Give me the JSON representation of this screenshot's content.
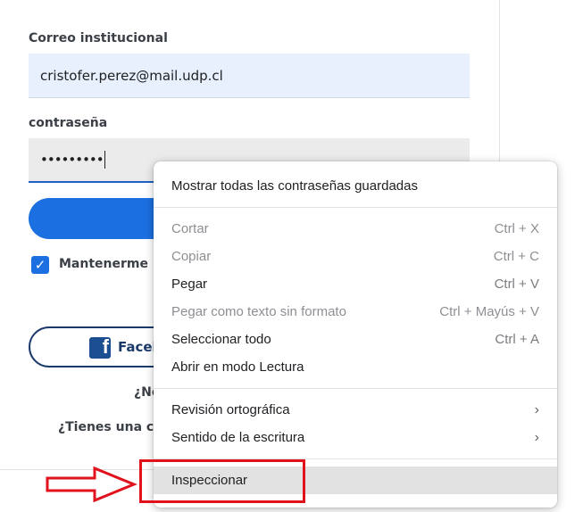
{
  "form": {
    "email_label": "Correo institucional",
    "email_value": "cristofer.perez@mail.udp.cl",
    "password_label": "contraseña",
    "password_value": "•••••••••",
    "remember_label": "Mantenerme re",
    "facebook_label": "Faceb",
    "forgot_text": "¿No",
    "account_text": "¿Tienes una cu"
  },
  "context_menu": {
    "show_passwords": "Mostrar todas las contraseñas guardadas",
    "cut": {
      "label": "Cortar",
      "shortcut": "Ctrl + X",
      "enabled": false
    },
    "copy": {
      "label": "Copiar",
      "shortcut": "Ctrl + C",
      "enabled": false
    },
    "paste": {
      "label": "Pegar",
      "shortcut": "Ctrl + V",
      "enabled": true
    },
    "paste_plain": {
      "label": "Pegar como texto sin formato",
      "shortcut": "Ctrl + Mayús + V",
      "enabled": false
    },
    "select_all": {
      "label": "Seleccionar todo",
      "shortcut": "Ctrl + A",
      "enabled": true
    },
    "reading_mode": "Abrir en modo Lectura",
    "spellcheck": "Revisión ortográfica",
    "writing_direction": "Sentido de la escritura",
    "inspect": "Inspeccionar"
  },
  "icons": {
    "checkbox": "check-icon",
    "facebook": "facebook-icon",
    "submenu": "chevron-right-icon"
  },
  "colors": {
    "primary": "#1b6fe0",
    "annotation": "#e0121d"
  }
}
